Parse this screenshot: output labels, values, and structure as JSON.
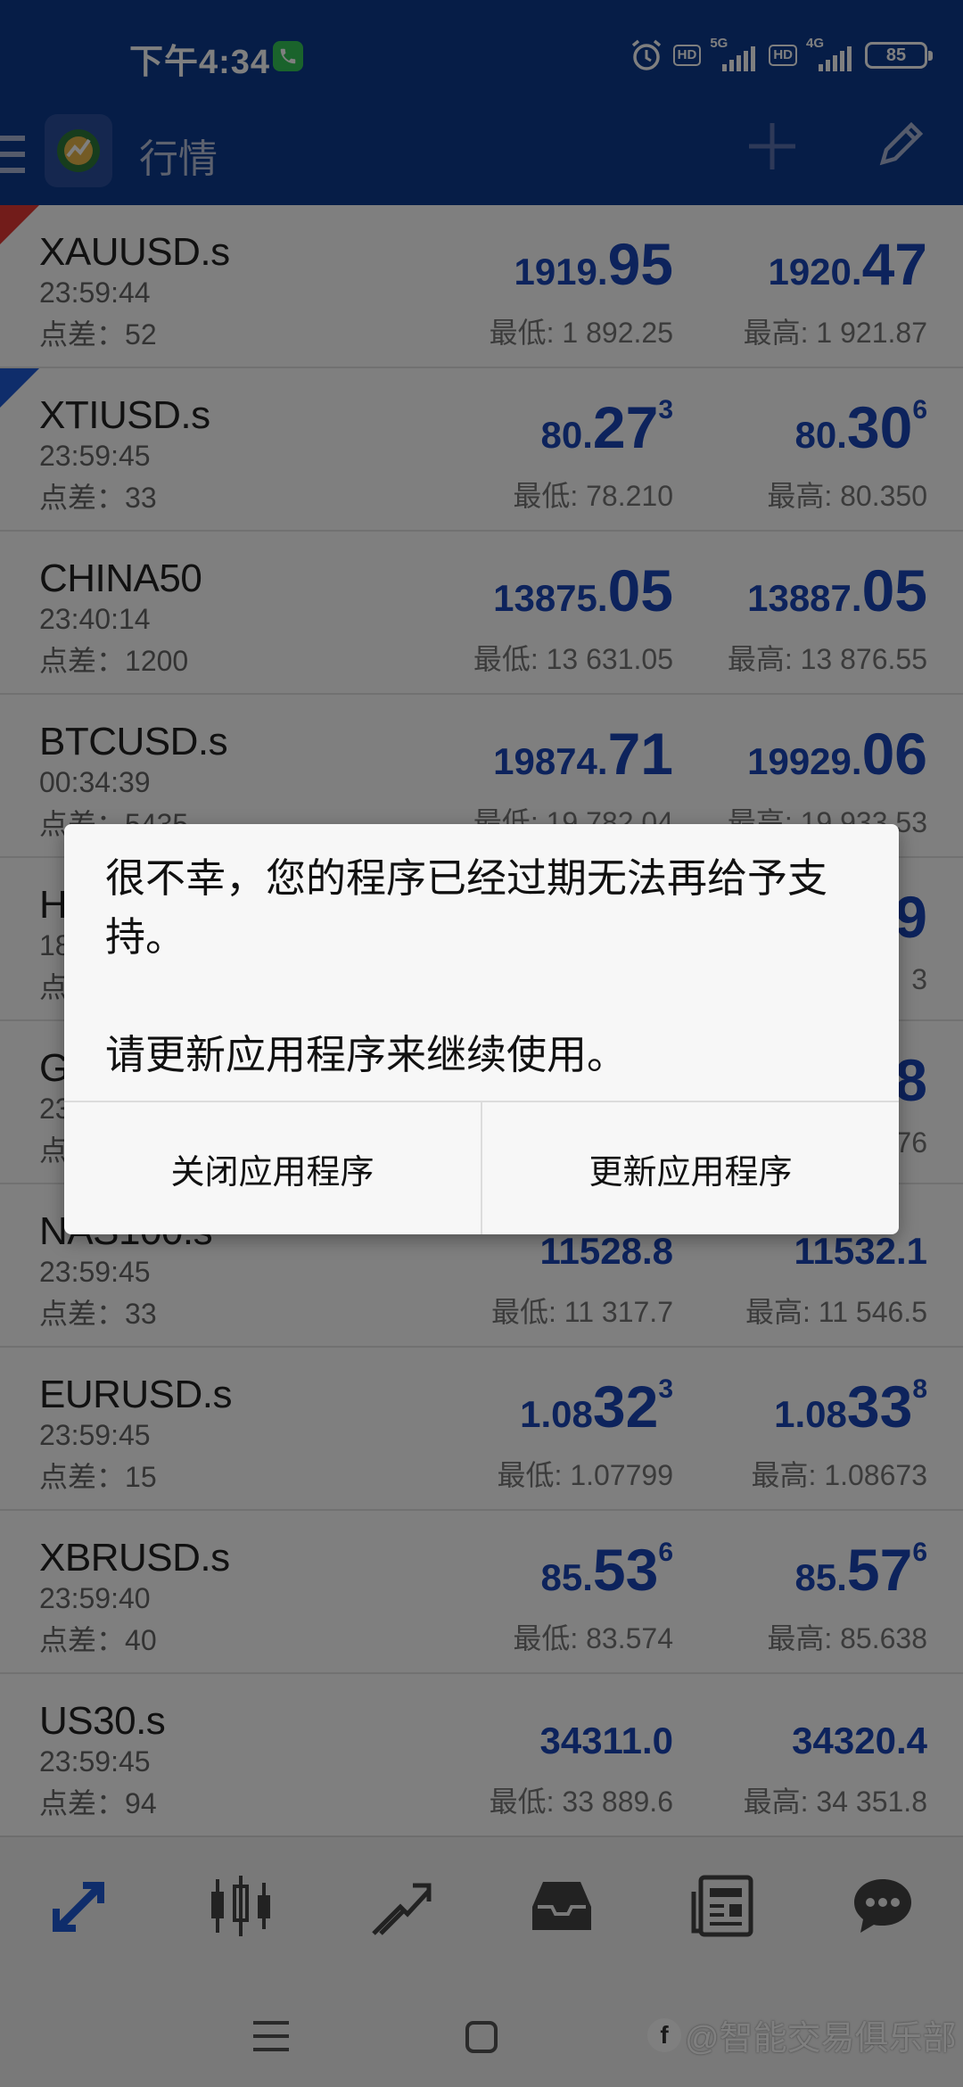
{
  "status_bar": {
    "time": "下午4:34",
    "hd": "HD",
    "net1": "5G",
    "net2": "4G",
    "battery": "85"
  },
  "app_bar": {
    "title": "行情"
  },
  "quotes": [
    {
      "symbol": "XAUUSD.s",
      "time": "23:59:44",
      "spread_label": "点差：",
      "spread": "52",
      "bid_small": "1919.",
      "bid_big": "95",
      "bid_sup": "",
      "ask_small": "1920.",
      "ask_big": "47",
      "ask_sup": "",
      "low": "最低: 1 892.25",
      "high": "最高: 1 921.87",
      "marker": "red"
    },
    {
      "symbol": "XTIUSD.s",
      "time": "23:59:45",
      "spread_label": "点差：",
      "spread": "33",
      "bid_small": "80.",
      "bid_big": "27",
      "bid_sup": "3",
      "ask_small": "80.",
      "ask_big": "30",
      "ask_sup": "6",
      "low": "最低: 78.210",
      "high": "最高: 80.350",
      "marker": "blue"
    },
    {
      "symbol": "CHINA50",
      "time": "23:40:14",
      "spread_label": "点差：",
      "spread": "1200",
      "bid_small": "13875.",
      "bid_big": "05",
      "bid_sup": "",
      "ask_small": "13887.",
      "ask_big": "05",
      "ask_sup": "",
      "low": "最低: 13 631.05",
      "high": "最高: 13 876.55",
      "marker": ""
    },
    {
      "symbol": "BTCUSD.s",
      "time": "00:34:39",
      "spread_label": "点差：",
      "spread": "5435",
      "bid_small": "19874.",
      "bid_big": "71",
      "bid_sup": "",
      "ask_small": "19929.",
      "ask_big": "06",
      "ask_sup": "",
      "low": "最低: 19 782.04",
      "high": "最高: 19 933.53",
      "marker": ""
    },
    {
      "symbol": "H",
      "time": "18",
      "spread_label": "点",
      "spread": "",
      "bid_small": "",
      "bid_big": "",
      "bid_sup": "",
      "ask_small": "",
      "ask_big": "9",
      "ask_sup": "",
      "low": "",
      "high": "3",
      "marker": ""
    },
    {
      "symbol": "G",
      "time": "23",
      "spread_label": "点",
      "spread": "",
      "bid_small": "",
      "bid_big": "",
      "bid_sup": "",
      "ask_small": "",
      "ask_big": "8",
      "ask_sup": "",
      "low": "",
      "high": "76",
      "marker": ""
    },
    {
      "symbol": "NAS100.s",
      "time": "23:59:45",
      "spread_label": "点差：",
      "spread": "33",
      "bid_small": "11528.8",
      "bid_big": "",
      "bid_sup": "",
      "ask_small": "11532.1",
      "ask_big": "",
      "ask_sup": "",
      "low": "最低: 11 317.7",
      "high": "最高: 11 546.5",
      "marker": ""
    },
    {
      "symbol": "EURUSD.s",
      "time": "23:59:45",
      "spread_label": "点差：",
      "spread": "15",
      "bid_small": "1.08",
      "bid_big": "32",
      "bid_sup": "3",
      "ask_small": "1.08",
      "ask_big": "33",
      "ask_sup": "8",
      "low": "最低: 1.07799",
      "high": "最高: 1.08673",
      "marker": ""
    },
    {
      "symbol": "XBRUSD.s",
      "time": "23:59:40",
      "spread_label": "点差：",
      "spread": "40",
      "bid_small": "85.",
      "bid_big": "53",
      "bid_sup": "6",
      "ask_small": "85.",
      "ask_big": "57",
      "ask_sup": "6",
      "low": "最低: 83.574",
      "high": "最高: 85.638",
      "marker": ""
    },
    {
      "symbol": "US30.s",
      "time": "23:59:45",
      "spread_label": "点差：",
      "spread": "94",
      "bid_small": "34311.0",
      "bid_big": "",
      "bid_sup": "",
      "ask_small": "34320.4",
      "ask_big": "",
      "ask_sup": "",
      "low": "最低: 33 889.6",
      "high": "最高: 34 351.8",
      "marker": ""
    }
  ],
  "dialog": {
    "message": "很不幸，您的程序已经过期无法再给予支持。",
    "message2": "请更新应用程序来继续使用。",
    "close_label": "关闭应用程序",
    "update_label": "更新应用程序"
  },
  "bottom_nav": {
    "icons": [
      "quotes-arrows-icon",
      "candlestick-chart-icon",
      "trade-trend-icon",
      "inbox-icon",
      "news-icon",
      "chat-icon"
    ]
  },
  "watermark": {
    "text": "@智能交易俱乐部"
  },
  "colors": {
    "header": "#0d3b8f",
    "price": "#1a47b8",
    "active_nav": "#1e5bd6"
  }
}
